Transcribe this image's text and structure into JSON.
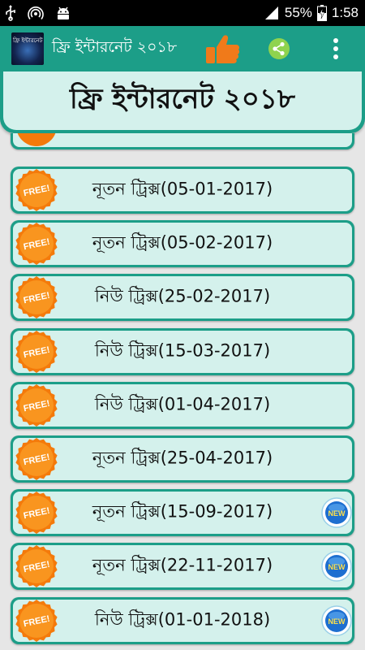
{
  "status_bar": {
    "battery": "55%",
    "time": "1:58"
  },
  "app_bar": {
    "title": "ফ্রি ইন্টারনেট ২০১৮",
    "logo_text": "ফ্রি ইন্টারনেট ২০১৮"
  },
  "banner": {
    "title": "ফ্রি ইন্টারনেট ২০১৮"
  },
  "list": {
    "badge_free": "FREE!",
    "badge_new": "NEW",
    "items": [
      {
        "label": "নূতন ট্রিক্স(05-01-2017)",
        "is_new": false
      },
      {
        "label": "নূতন ট্রিক্স(05-02-2017)",
        "is_new": false
      },
      {
        "label": "নিউ ট্রিক্স(25-02-2017)",
        "is_new": false
      },
      {
        "label": "নিউ ট্রিক্স(15-03-2017)",
        "is_new": false
      },
      {
        "label": "নিউ ট্রিক্স(01-04-2017)",
        "is_new": false
      },
      {
        "label": "নূতন ট্রিক্স(25-04-2017)",
        "is_new": false
      },
      {
        "label": "নূতন ট্রিক্স(15-09-2017)",
        "is_new": true
      },
      {
        "label": "নূতন ট্রিক্স(22-11-2017)",
        "is_new": true
      },
      {
        "label": "নিউ ট্রিক্স(01-01-2018)",
        "is_new": true
      }
    ]
  },
  "colors": {
    "accent": "#1c9e88",
    "item_face": "#d4f1ec",
    "badge_orange": "#f47a0b",
    "new_badge_blue": "#1e6fd0"
  }
}
